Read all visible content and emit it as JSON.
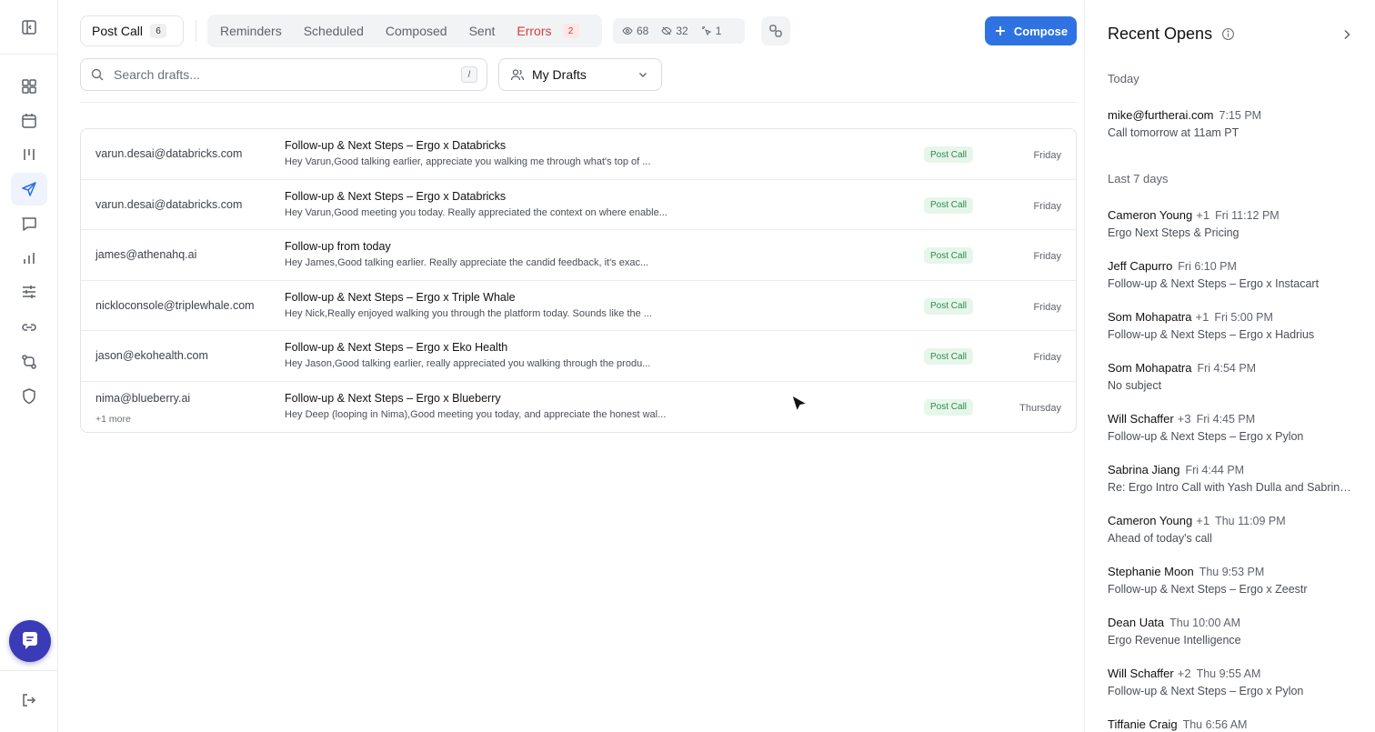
{
  "toolbar": {
    "post_call_label": "Post Call",
    "post_call_count": "6",
    "tabs": [
      "Reminders",
      "Scheduled",
      "Composed",
      "Sent"
    ],
    "errors_label": "Errors",
    "errors_count": "2",
    "stats": {
      "opened": "68",
      "unopened": "32",
      "clicked": "1"
    },
    "compose_label": "Compose"
  },
  "search": {
    "placeholder": "Search drafts...",
    "shortcut": "/"
  },
  "drafts_filter": {
    "selected": "My Drafts"
  },
  "emails": [
    {
      "to": "varun.desai@databricks.com",
      "more": "",
      "subject": "Follow-up & Next Steps – Ergo x Databricks",
      "snippet": "Hey Varun,Good talking earlier, appreciate you walking me through what's top of ...",
      "badge": "Post Call",
      "date": "Friday"
    },
    {
      "to": "varun.desai@databricks.com",
      "more": "",
      "subject": "Follow-up & Next Steps – Ergo x Databricks",
      "snippet": "Hey Varun,Good meeting you today. Really appreciated the context on where enable...",
      "badge": "Post Call",
      "date": "Friday"
    },
    {
      "to": "james@athenahq.ai",
      "more": "",
      "subject": "Follow-up from today",
      "snippet": "Hey James,Good talking earlier. Really appreciate the candid feedback, it's exac...",
      "badge": "Post Call",
      "date": "Friday"
    },
    {
      "to": "nickloconsole@triplewhale.com",
      "more": "",
      "subject": "Follow-up & Next Steps – Ergo x Triple Whale",
      "snippet": "Hey Nick,Really enjoyed walking you through the platform today. Sounds like the ...",
      "badge": "Post Call",
      "date": "Friday"
    },
    {
      "to": "jason@ekohealth.com",
      "more": "",
      "subject": "Follow-up & Next Steps – Ergo x Eko Health",
      "snippet": "Hey Jason,Good talking earlier, really appreciated you walking through the produ...",
      "badge": "Post Call",
      "date": "Friday"
    },
    {
      "to": "nima@blueberry.ai",
      "more": "+1 more",
      "subject": "Follow-up & Next Steps – Ergo x Blueberry",
      "snippet": "Hey Deep (looping in Nima),Good meeting you today, and appreciate the honest wal...",
      "badge": "Post Call",
      "date": "Thursday"
    }
  ],
  "recent_opens": {
    "title": "Recent Opens",
    "today_label": "Today",
    "last7_label": "Last 7 days",
    "today": [
      {
        "name": "mike@furtherai.com",
        "extra": "",
        "time": "7:15 PM",
        "subject": "Call tomorrow at 11am PT"
      }
    ],
    "last7": [
      {
        "name": "Cameron Young",
        "extra": "+1",
        "time": "Fri 11:12 PM",
        "subject": "Ergo Next Steps & Pricing"
      },
      {
        "name": "Jeff Capurro",
        "extra": "",
        "time": "Fri 6:10 PM",
        "subject": "Follow-up & Next Steps – Ergo x Instacart"
      },
      {
        "name": "Som Mohapatra",
        "extra": "+1",
        "time": "Fri 5:00 PM",
        "subject": "Follow-up & Next Steps – Ergo x Hadrius"
      },
      {
        "name": "Som Mohapatra",
        "extra": "",
        "time": "Fri 4:54 PM",
        "subject": "No subject"
      },
      {
        "name": "Will Schaffer",
        "extra": "+3",
        "time": "Fri 4:45 PM",
        "subject": "Follow-up & Next Steps – Ergo x Pylon"
      },
      {
        "name": "Sabrina Jiang",
        "extra": "",
        "time": "Fri 4:44 PM",
        "subject": "Re: Ergo Intro Call with Yash Dulla and Sabrina Jiang"
      },
      {
        "name": "Cameron Young",
        "extra": "+1",
        "time": "Thu 11:09 PM",
        "subject": "Ahead of today's call"
      },
      {
        "name": "Stephanie Moon",
        "extra": "",
        "time": "Thu 9:53 PM",
        "subject": "Follow-up & Next Steps – Ergo x Zeestr"
      },
      {
        "name": "Dean Uata",
        "extra": "",
        "time": "Thu 10:00 AM",
        "subject": "Ergo Revenue Intelligence"
      },
      {
        "name": "Will Schaffer",
        "extra": "+2",
        "time": "Thu 9:55 AM",
        "subject": "Follow-up & Next Steps – Ergo x Pylon"
      },
      {
        "name": "Tiffanie Craig",
        "extra": "",
        "time": "Thu 6:56 AM",
        "subject": ""
      }
    ]
  },
  "colors": {
    "accent": "#2f73e3",
    "error": "#d63b3b",
    "badge_bg": "#e6f6ea",
    "badge_fg": "#2f8a4a",
    "chat": "#3b3bb8"
  }
}
